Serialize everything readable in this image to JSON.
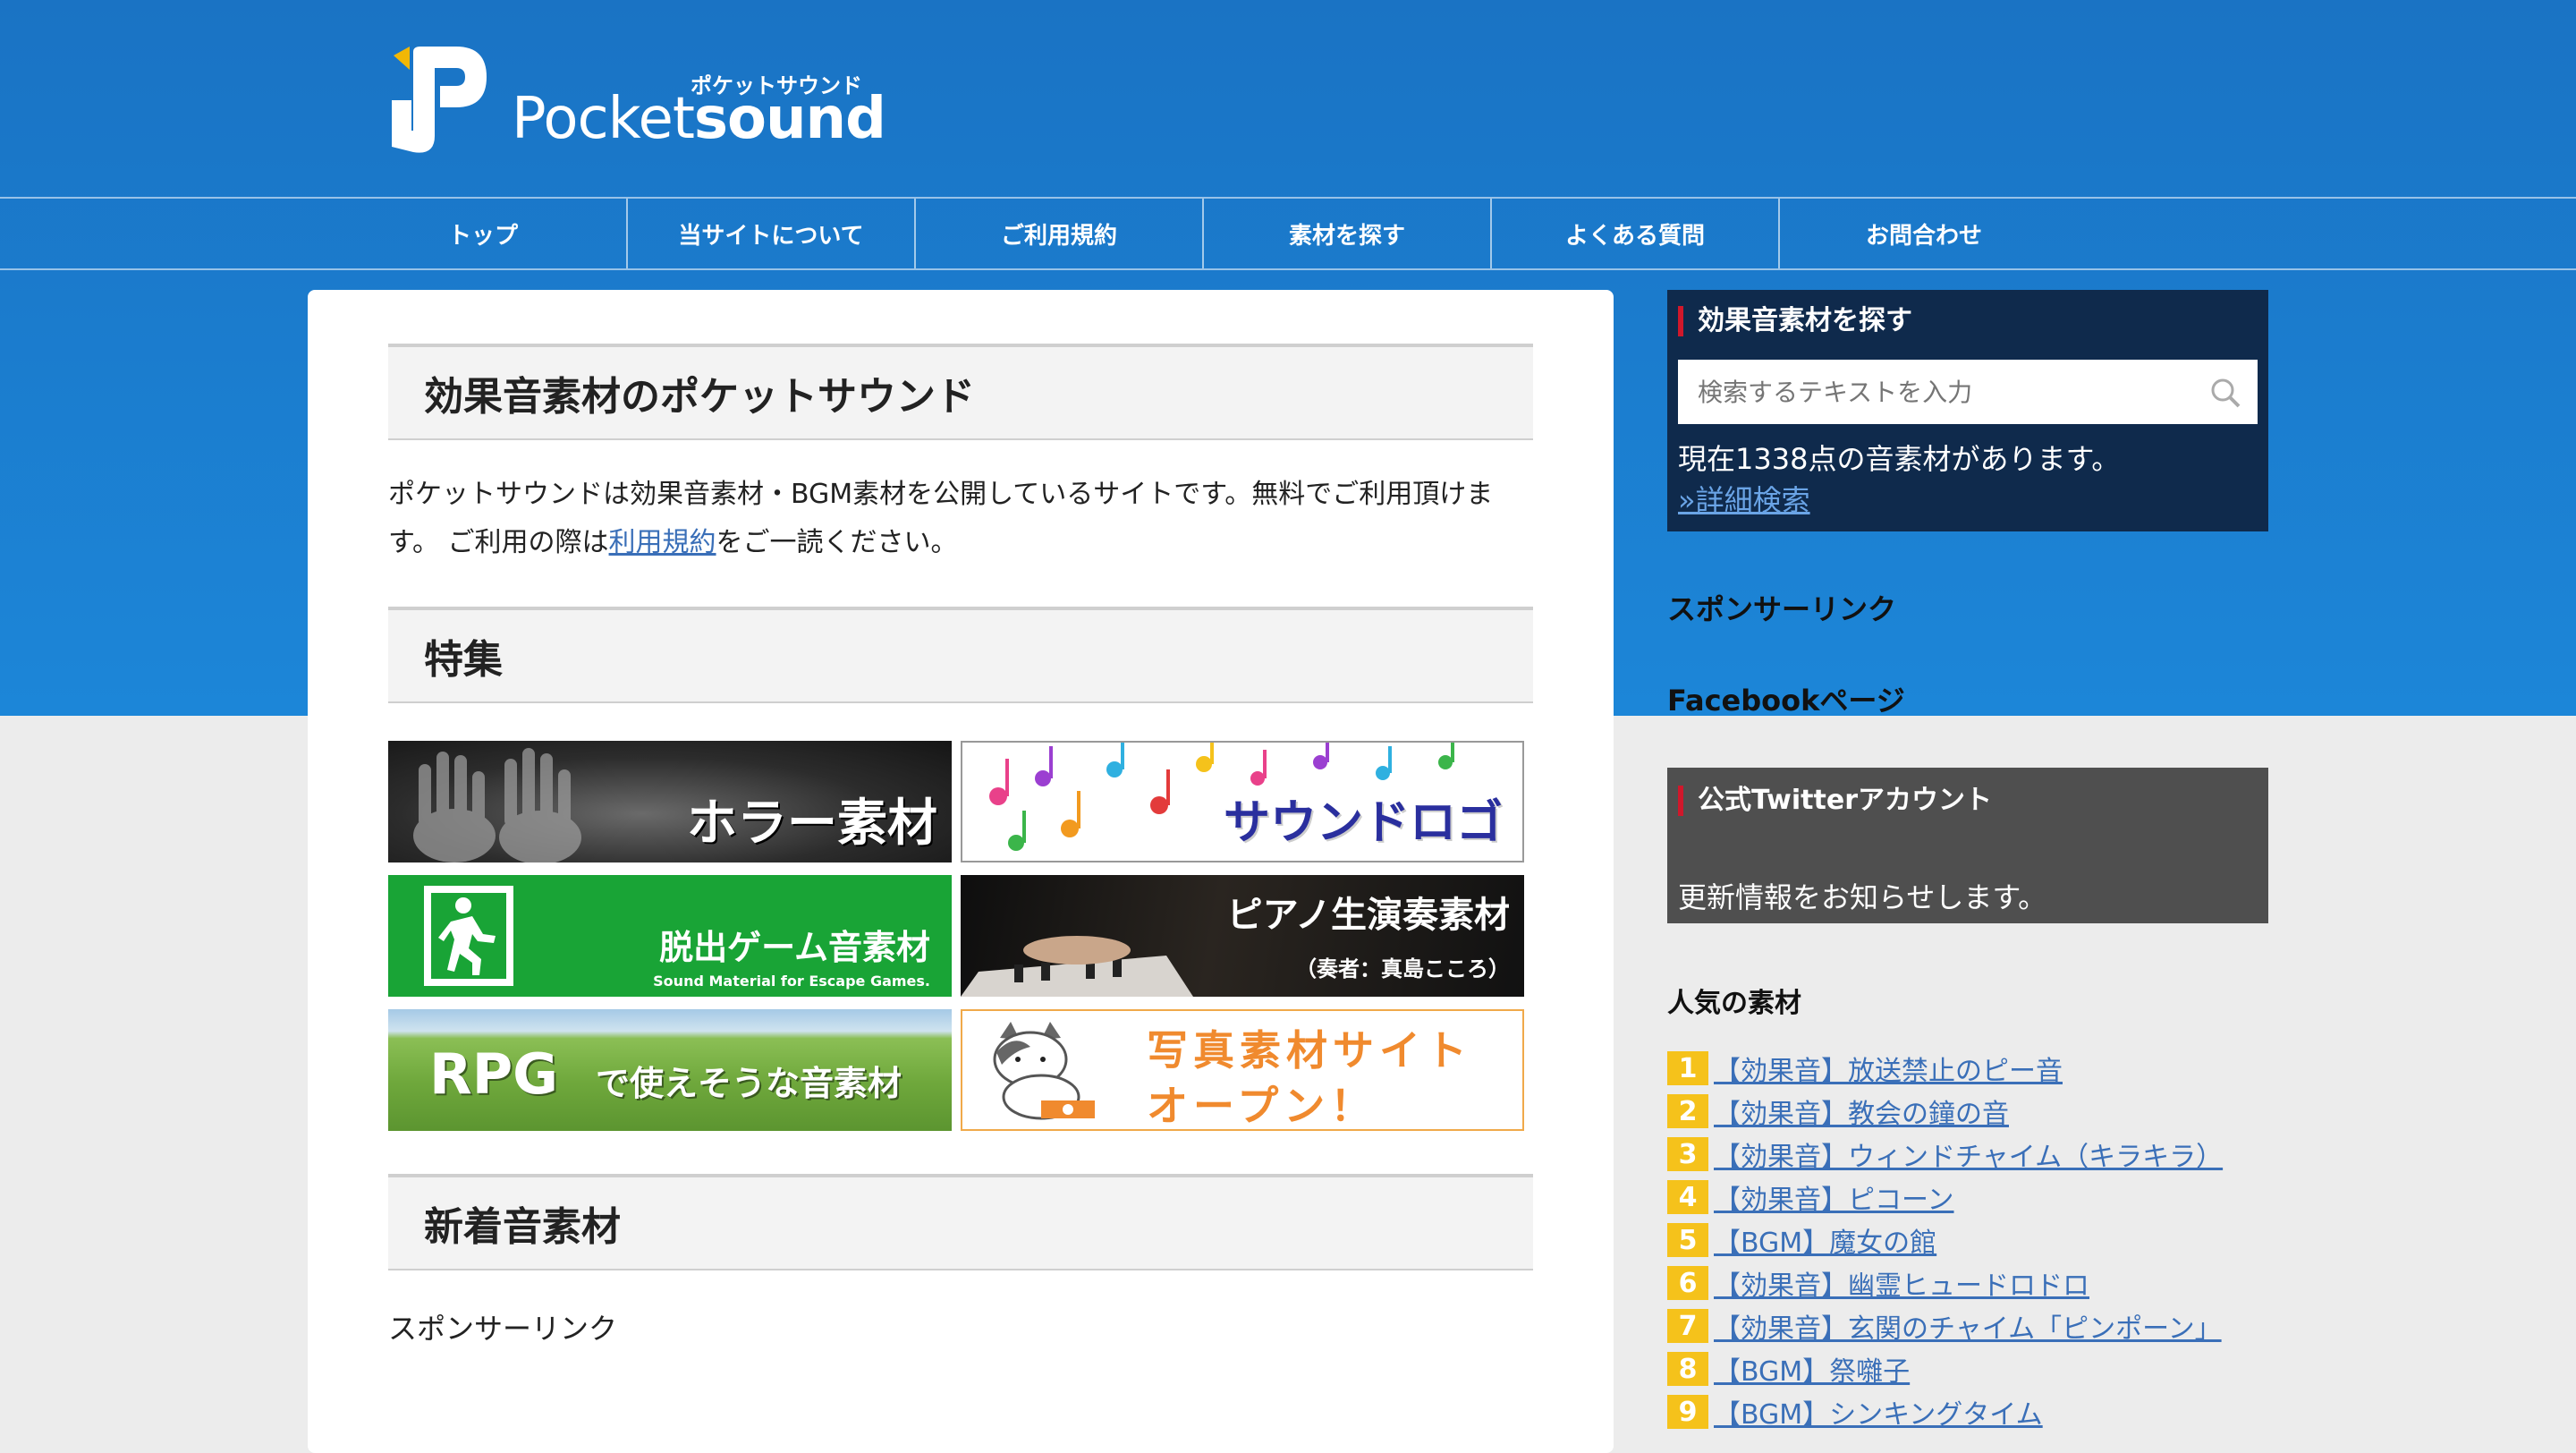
{
  "header": {
    "logo_main": "Pocket",
    "logo_bold": "sound",
    "logo_kana": "ポケットサウンド"
  },
  "nav": {
    "items": [
      {
        "label": "トップ"
      },
      {
        "label": "当サイトについて"
      },
      {
        "label": "ご利用規約"
      },
      {
        "label": "素材を探す"
      },
      {
        "label": "よくある質問"
      },
      {
        "label": "お問合わせ"
      }
    ]
  },
  "main": {
    "title": "効果音素材のポケットサウンド",
    "intro_part1": "ポケットサウンドは効果音素材・BGM素材を公開しているサイトです。無料でご利用頂けます。 ご利用の際は",
    "intro_link": "利用規約",
    "intro_part2": "をご一読ください。",
    "feature_heading": "特集",
    "banners": [
      {
        "label": "ホラー素材"
      },
      {
        "label": "サウンドロゴ"
      },
      {
        "label": "脱出ゲーム音素材",
        "sub": "Sound Material for Escape Games."
      },
      {
        "label": "ピアノ生演奏素材",
        "sub": "（奏者：真島こころ）"
      },
      {
        "label_a": "RPG",
        "label_b": "で使えそうな音素材"
      },
      {
        "label_a": "写真素材サイト",
        "label_b": "オープン！"
      }
    ],
    "new_heading": "新着音素材",
    "sponsor": "スポンサーリンク"
  },
  "sidebar": {
    "search_title": "効果音素材を探す",
    "search_placeholder": "検索するテキストを入力",
    "count_text": "現在1338点の音素材があります。",
    "advanced_link": "»詳細検索",
    "sponsor_label": "スポンサーリンク",
    "facebook_label": "Facebookページ",
    "twitter_title": "公式Twitterアカウント",
    "twitter_text": "更新情報をお知らせします。",
    "popular_title": "人気の素材",
    "popular": [
      {
        "rank": "1",
        "title": "【効果音】放送禁止のピー音"
      },
      {
        "rank": "2",
        "title": "【効果音】教会の鐘の音"
      },
      {
        "rank": "3",
        "title": "【効果音】ウィンドチャイム（キラキラ）"
      },
      {
        "rank": "4",
        "title": "【効果音】ピコーン"
      },
      {
        "rank": "5",
        "title": "【BGM】魔女の館"
      },
      {
        "rank": "6",
        "title": "【効果音】幽霊ヒュードロドロ"
      },
      {
        "rank": "7",
        "title": "【効果音】玄関のチャイム「ピンポーン」"
      },
      {
        "rank": "8",
        "title": "【BGM】祭囃子"
      },
      {
        "rank": "9",
        "title": "【BGM】シンキングタイム"
      }
    ]
  },
  "colors": {
    "header_blue": "#1a73c4",
    "search_bg": "#0f2a4c",
    "twitter_bg": "#4f4f4f",
    "rank_badge": "#f5c21b",
    "link": "#3a6fb8"
  }
}
